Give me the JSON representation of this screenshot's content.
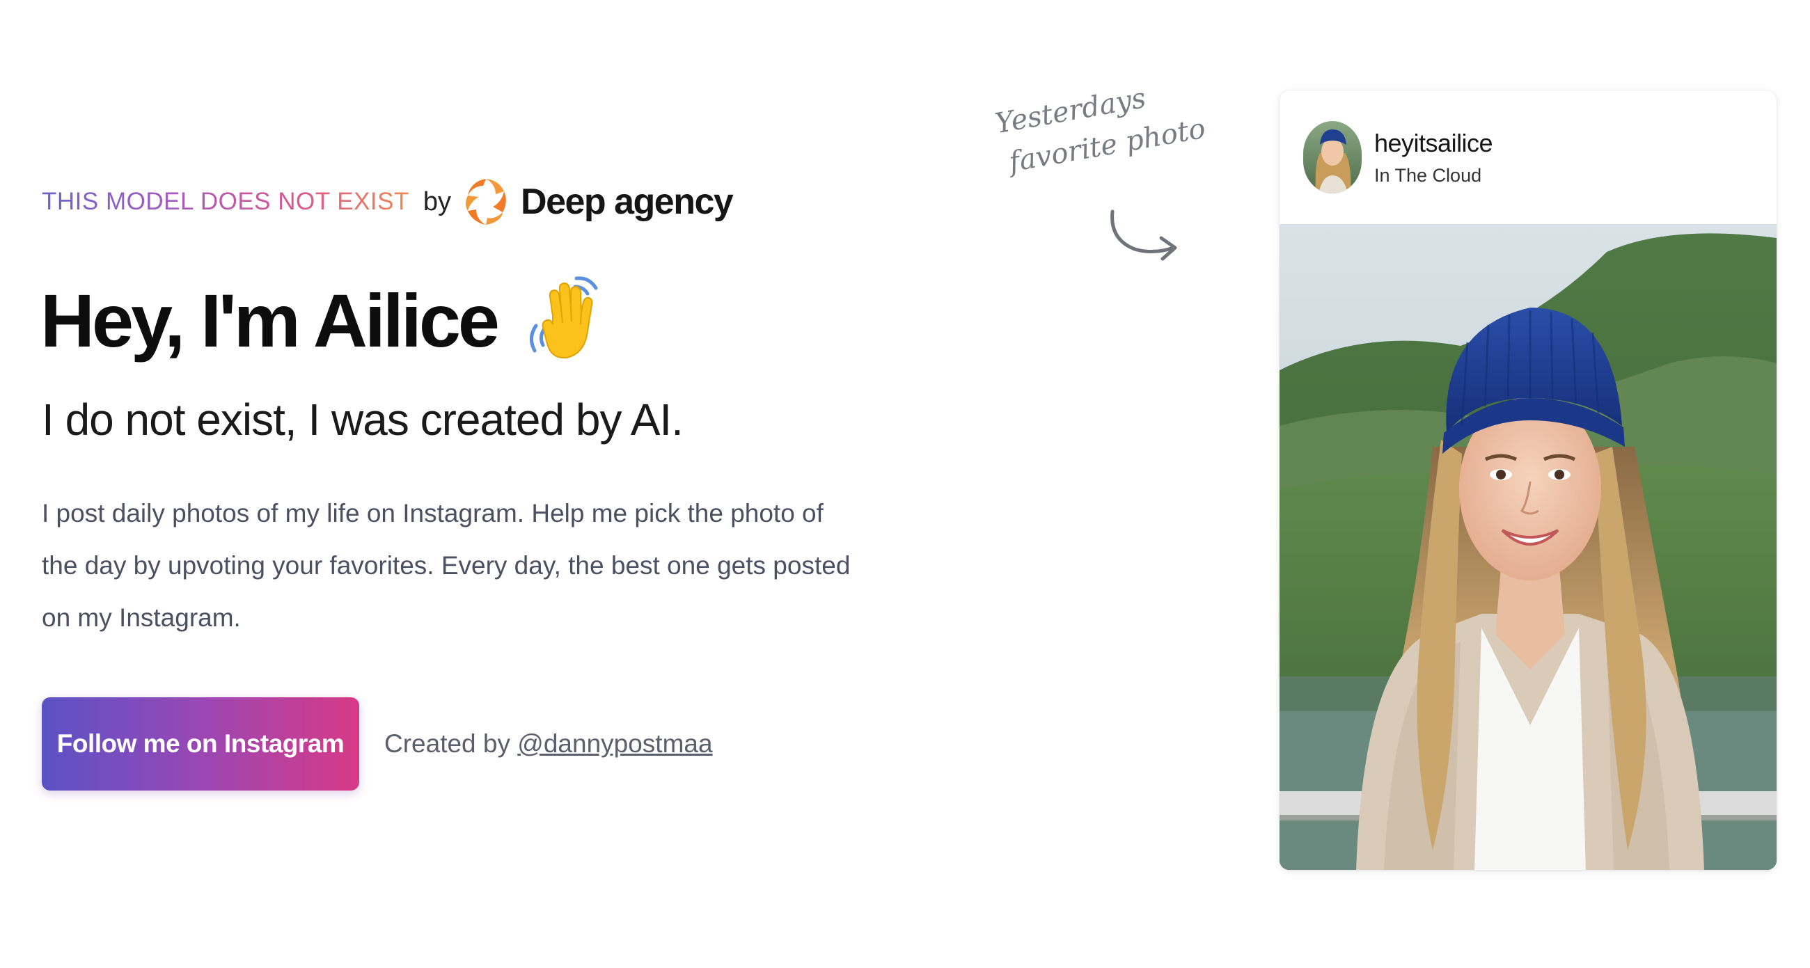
{
  "brand": {
    "tagline": "THIS MODEL DOES NOT EXIST",
    "by": "by",
    "company": "Deep agency"
  },
  "hero": {
    "title": "Hey, I'm Ailice",
    "subtitle": "I do not exist, I was created by AI.",
    "description": "I post daily photos of my life on Instagram. Help me pick the photo of the day by upvoting your favorites. Every day, the best one gets posted on my Instagram."
  },
  "cta": {
    "button_label": "Follow me on Instagram",
    "credit_prefix": "Created by ",
    "credit_handle": "@dannypostmaa"
  },
  "annotation": {
    "line1": "Yesterdays",
    "line2": "favorite photo"
  },
  "instagram_post": {
    "username": "heyitsailice",
    "location": "In The Cloud"
  },
  "colors": {
    "button_gradient": [
      "#5b52c5",
      "#9a47b4",
      "#d83a86"
    ],
    "tagline_gradient": [
      "#6b63c9",
      "#a45bbf",
      "#d9578e",
      "#ef8a52"
    ],
    "logo_orange": "#f07a26",
    "beanie_blue": "#1f3f8f"
  },
  "icons": {
    "brand_logo": "deep-agency-logo",
    "wave": "waving-hand-emoji",
    "annotation_arrow": "curved-arrow"
  }
}
